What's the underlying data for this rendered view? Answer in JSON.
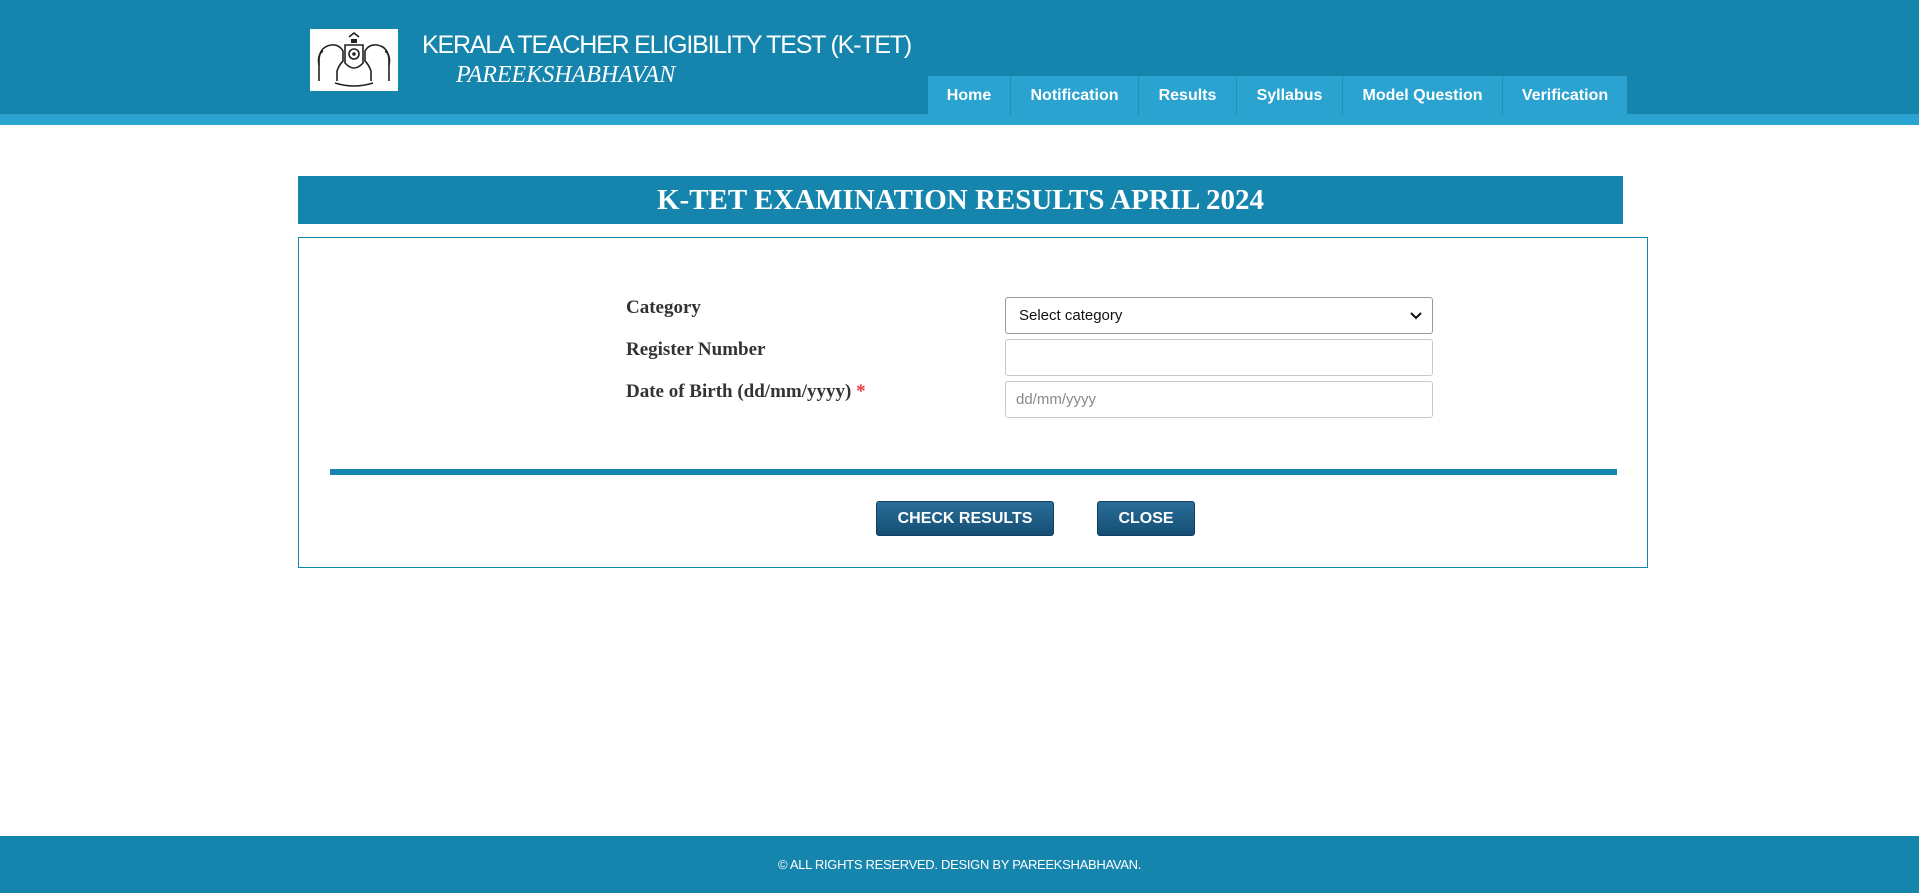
{
  "header": {
    "title": "KERALA TEACHER ELIGIBILITY TEST (K-TET)",
    "subtitle": "PAREEKSHABHAVAN",
    "logo": "kerala-emblem-icon"
  },
  "nav": {
    "items": [
      {
        "label": "Home"
      },
      {
        "label": "Notification"
      },
      {
        "label": "Results"
      },
      {
        "label": "Syllabus"
      },
      {
        "label": "Model Question"
      },
      {
        "label": "Verification"
      }
    ]
  },
  "page": {
    "title": "K-TET EXAMINATION RESULTS APRIL 2024"
  },
  "form": {
    "category_label": "Category",
    "category_value": "Select category",
    "register_label": "Register Number",
    "register_value": "",
    "dob_label": "Date of Birth (dd/mm/yyyy)",
    "dob_required_mark": "*",
    "dob_placeholder": "dd/mm/yyyy",
    "check_button": "CHECK RESULTS",
    "close_button": "CLOSE"
  },
  "footer": {
    "text": "© ALL RIGHTS RESERVED. DESIGN BY PAREEKSHABHAVAN."
  },
  "colors": {
    "primary": "#1585ae",
    "nav_bg": "#2ba3d1",
    "button": "#1f5f88",
    "required": "#e53935"
  }
}
